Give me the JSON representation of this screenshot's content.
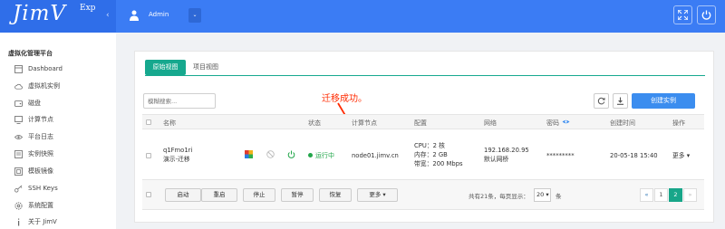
{
  "header": {
    "logo": "JimV",
    "logo_sup": "Exp",
    "user": "Admin",
    "icons": [
      "user-icon",
      "fullscreen-icon",
      "power-icon"
    ]
  },
  "sidebar": {
    "title": "虚拟化管理平台",
    "items": [
      {
        "label": "Dashboard",
        "icon": "dashboard-icon"
      },
      {
        "label": "虚拟机实例",
        "icon": "cloud-icon"
      },
      {
        "label": "磁盘",
        "icon": "disk-icon"
      },
      {
        "label": "计算节点",
        "icon": "monitor-icon"
      },
      {
        "label": "平台日志",
        "icon": "eye-icon"
      },
      {
        "label": "实例快照",
        "icon": "snapshot-icon"
      },
      {
        "label": "模板镜像",
        "icon": "image-icon"
      },
      {
        "label": "SSH Keys",
        "icon": "key-icon"
      },
      {
        "label": "系统配置",
        "icon": "gear-icon"
      },
      {
        "label": "关于 JimV",
        "icon": "info-icon"
      }
    ]
  },
  "main": {
    "tabs": [
      {
        "label": "原始视图"
      },
      {
        "label": "项目视图"
      }
    ],
    "search_placeholder": "模糊搜索...",
    "annotation": "迁移成功。",
    "create_label": "创建实例",
    "columns": {
      "name": "名称",
      "status": "状态",
      "node": "计算节点",
      "config": "配置",
      "network": "网络",
      "password": "密码",
      "created": "创建时间",
      "ops": "操作"
    },
    "row": {
      "uuid": "q1Fmo1ri",
      "name": "演示-迁移",
      "status": "运行中",
      "node": "node01.jimv.cn",
      "cpu": "CPU：2 核",
      "memory": "内存：2 GB",
      "bandwidth": "带宽：200 Mbps",
      "ip": "192.168.20.95",
      "network_name": "默认网桥",
      "password": "*********",
      "created": "20-05-18 15:40",
      "more": "更多"
    },
    "footer": {
      "buttons": [
        "启动",
        "重启",
        "停止",
        "暂停",
        "恢复",
        "更多"
      ],
      "page_info": "共有21条，每页显示：",
      "page_size": "20",
      "page_unit": "条",
      "pages": [
        "«",
        "1",
        "2",
        "»"
      ],
      "current_page": "2"
    }
  },
  "colors": {
    "topbar": "#3b7cf4",
    "accent": "#16a88e",
    "primary_button": "#3b8def",
    "status_running": "#22a64a",
    "annotation": "#ff2a00"
  }
}
